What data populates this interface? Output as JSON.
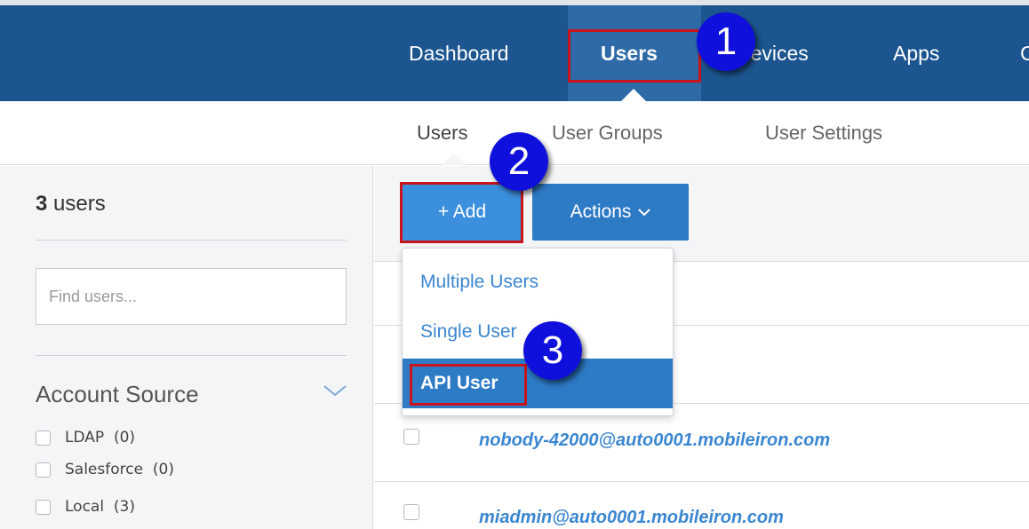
{
  "nav": {
    "items": [
      "Dashboard",
      "Users",
      "Devices",
      "Apps",
      "C"
    ],
    "active": "Users"
  },
  "subnav": {
    "items": [
      "Users",
      "User Groups",
      "User Settings"
    ],
    "active": "Users"
  },
  "sidebar": {
    "count_number": "3",
    "count_label": "users",
    "search_placeholder": "Find users...",
    "facet_title": "Account Source",
    "facet_options": [
      {
        "label": "LDAP",
        "count": "(0)"
      },
      {
        "label": "Salesforce",
        "count": "(0)"
      },
      {
        "label": "Local",
        "count": "(3)"
      }
    ]
  },
  "toolbar": {
    "add_label": "+ Add",
    "actions_label": "Actions"
  },
  "add_menu": {
    "items": [
      "Multiple Users",
      "Single User",
      "API User"
    ],
    "selected": "API User"
  },
  "users_list": [
    {
      "email": "nobody-42000@auto0001.mobileiron.com"
    },
    {
      "email": "miadmin@auto0001.mobileiron.com"
    }
  ],
  "step_markers": [
    "1",
    "2",
    "3"
  ],
  "colors": {
    "topnav_bg": "#1c558f",
    "topnav_active": "#2d6aa7",
    "primary_button": "#3b8fdc",
    "secondary_button": "#2d7ac5",
    "link": "#3b86d0",
    "highlight_border": "#c8151b",
    "marker_fill": "#1010dd"
  }
}
